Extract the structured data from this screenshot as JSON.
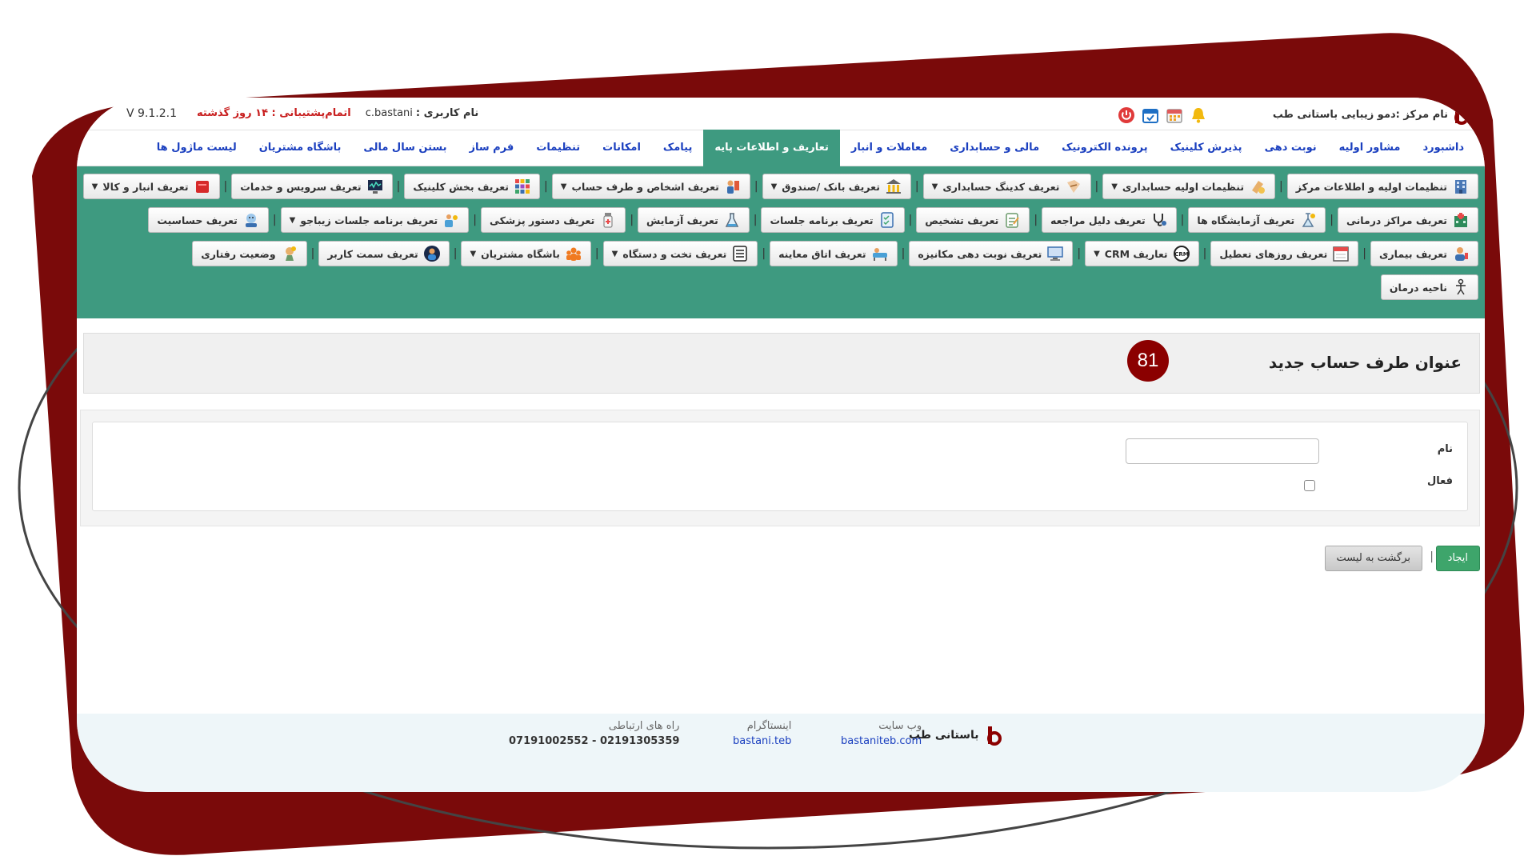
{
  "window": {
    "center_name": "نام مرکز :دمو زیبایی باستانی طب",
    "user_label": "نام کاربری :",
    "user_value": "c.bastani",
    "support_label": "اتمام‌پشتیبانی : ۱۴ روز گذشته",
    "version": "V 9.1.2.1"
  },
  "icons": {
    "bell": "bell-icon",
    "calendar": "calendar-icon",
    "calendar_check": "calendar-check-icon",
    "power": "power-icon"
  },
  "colors": {
    "accent": "#3e9a80",
    "nav_text": "#1a3fbf",
    "brand": "#8b0000",
    "create_button": "#3ea56b"
  },
  "main_nav": [
    {
      "label": "داشبورد",
      "active": false
    },
    {
      "label": "مشاور اولیه",
      "active": false
    },
    {
      "label": "نوبت دهی",
      "active": false
    },
    {
      "label": "پذیرش کلینیک",
      "active": false
    },
    {
      "label": "پرونده الکترونیک",
      "active": false
    },
    {
      "label": "مالی و حسابداری",
      "active": false
    },
    {
      "label": "معاملات و انبار",
      "active": false
    },
    {
      "label": "تعاریف و اطلاعات پایه",
      "active": true
    },
    {
      "label": "پیامک",
      "active": false
    },
    {
      "label": "امکانات",
      "active": false
    },
    {
      "label": "تنظیمات",
      "active": false
    },
    {
      "label": "فرم ساز",
      "active": false
    },
    {
      "label": "بستن سال مالی",
      "active": false
    },
    {
      "label": "باشگاه مشتریان",
      "active": false
    },
    {
      "label": "لیست ماژول ها",
      "active": false
    }
  ],
  "submenu": {
    "rows": [
      [
        {
          "label": "تنظیمات اولیه و اطلاعات مرکز",
          "icon": "building-icon",
          "dropdown": false
        },
        {
          "label": "تنظیمات اولیه حسابداری",
          "icon": "calculator-icon",
          "dropdown": true
        },
        {
          "label": "تعریف کدینگ حسابداری",
          "icon": "coding-icon",
          "dropdown": true
        },
        {
          "label": "تعریف بانک /صندوق",
          "icon": "bank-icon",
          "dropdown": true
        },
        {
          "label": "تعریف اشخاص و طرف حساب",
          "icon": "people-icon",
          "dropdown": true
        },
        {
          "label": "تعریف بخش کلینیک",
          "icon": "grid-icon",
          "dropdown": false
        },
        {
          "label": "تعریف سرویس و خدمات",
          "icon": "monitor-icon",
          "dropdown": false
        },
        {
          "label": "تعریف انبار و کالا",
          "icon": "box-icon",
          "dropdown": true
        }
      ],
      [
        {
          "label": "تعریف مراکز درمانی",
          "icon": "hospital-icon",
          "dropdown": false
        },
        {
          "label": "تعریف آزمایشگاه ها",
          "icon": "lab-icon",
          "dropdown": false
        },
        {
          "label": "تعریف دلیل مراجعه",
          "icon": "stethoscope-icon",
          "dropdown": false
        },
        {
          "label": "تعریف تشخیص",
          "icon": "clipboard-icon",
          "dropdown": false
        },
        {
          "label": "تعریف برنامه جلسات",
          "icon": "checklist-icon",
          "dropdown": false
        },
        {
          "label": "تعریف آزمایش",
          "icon": "flask-icon",
          "dropdown": false
        },
        {
          "label": "تعریف دستور پزشکی",
          "icon": "medicine-icon",
          "dropdown": false
        },
        {
          "label": "تعریف برنامه جلسات زیباجو",
          "icon": "beauty-icon",
          "dropdown": true
        },
        {
          "label": "تعریف حساسیت",
          "icon": "allergy-icon",
          "dropdown": false
        }
      ],
      [
        {
          "label": "تعریف بیماری",
          "icon": "patient-icon",
          "dropdown": false
        },
        {
          "label": "تعریف روزهای تعطیل",
          "icon": "holiday-calendar-icon",
          "dropdown": false
        },
        {
          "label": "تعاریف CRM",
          "icon": "crm-icon",
          "dropdown": true
        },
        {
          "label": "تعریف نوبت دهی مکانیزه",
          "icon": "computer-icon",
          "dropdown": false
        },
        {
          "label": "تعریف اتاق معاینه",
          "icon": "exam-room-icon",
          "dropdown": false
        },
        {
          "label": "تعریف تخت و دستگاه",
          "icon": "bed-list-icon",
          "dropdown": true
        },
        {
          "label": "باشگاه مشتریان",
          "icon": "club-icon",
          "dropdown": true
        },
        {
          "label": "تعریف سمت کاربر",
          "icon": "user-role-icon",
          "dropdown": false
        },
        {
          "label": "وضعیت رفتاری",
          "icon": "behavior-icon",
          "dropdown": false
        }
      ],
      [
        {
          "label": "ناحیه درمان",
          "icon": "body-icon",
          "dropdown": false
        }
      ]
    ]
  },
  "page": {
    "title": "عنوان طرف حساب جدید",
    "badge": "81"
  },
  "form": {
    "name_label": "نام",
    "name_value": "",
    "active_label": "فعال",
    "active_checked": false
  },
  "actions": {
    "create_label": "ایجاد",
    "separator": "|",
    "back_label": "برگشت به لیست"
  },
  "footer": {
    "brand": "باستانی طب",
    "website_label": "وب سایت",
    "website_value": "bastaniteb.com",
    "instagram_label": "اینستاگرام",
    "instagram_value": "bastani.teb",
    "contact_label": "راه های ارتباطی",
    "contact_value": "07191002552 - 02191305359"
  }
}
